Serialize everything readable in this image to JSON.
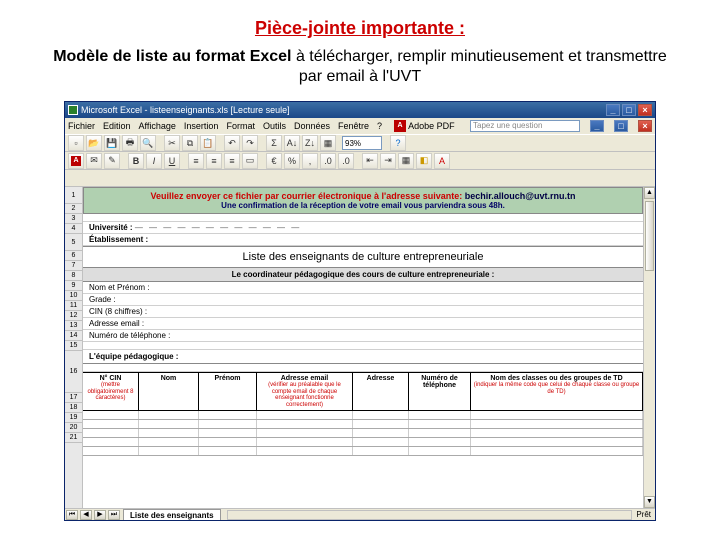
{
  "header": {
    "title_red": "Pièce-jointe importante :",
    "subtitle_bold": "Modèle de liste au format Excel",
    "subtitle_rest": " à télécharger, remplir minutieusement et transmettre par email à l'UVT"
  },
  "titlebar": {
    "app": "Microsoft Excel - listeenseignants.xls [Lecture seule]",
    "min": "_",
    "max": "□",
    "close": "×"
  },
  "menubar": {
    "file": "Fichier",
    "edit": "Edition",
    "view": "Affichage",
    "insert": "Insertion",
    "format": "Format",
    "tools": "Outils",
    "data": "Données",
    "window": "Fenêtre",
    "help": "?",
    "adobe": "Adobe PDF",
    "help_hint": "Tapez une question"
  },
  "toolbar": {
    "zoom": "93%"
  },
  "rows": [
    "",
    "1",
    "2",
    "3",
    "4",
    "5",
    "6",
    "7",
    "8",
    "9",
    "10",
    "11",
    "12",
    "13",
    "14",
    "15",
    "16",
    "17",
    "18",
    "19",
    "20",
    "21"
  ],
  "sheet": {
    "banner_l1_pre": "Veuillez envoyer ce fichier par courrier électronique à l'adresse suivante: ",
    "banner_l1_mail": "bechir.allouch@uvt.rnu.tn",
    "banner_l2": "Une confirmation de la réception de votre email vous parviendra sous 48h.",
    "universite": "Université :",
    "dashes": "— — — — — — — — — — — —",
    "etab": "Établissement :",
    "liste_title": "Liste des enseignants de culture entrepreneuriale",
    "coord_header": "Le coordinateur pédagogique des cours de culture entrepreneuriale :",
    "nom_prenom": "Nom et Prénom :",
    "grade": "Grade :",
    "cin": "CIN (8 chiffres) :",
    "email": "Adresse email :",
    "tel": "Numéro de téléphone :",
    "equipe": "L'équipe pédagogique :",
    "col_num": "N° CIN",
    "col_num_sub": "(mettre obligatoirement 8 caractères)",
    "col_nom": "Nom",
    "col_prenom": "Prénom",
    "col_mail": "Adresse email",
    "col_mail_sub": "(vérifier au préalable que le compte email de chaque enseignant fonctionne correctement)",
    "col_addr": "Adresse",
    "col_tel": "Numéro de téléphone",
    "col_class": "Nom des classes ou des groupes de TD",
    "col_class_sub": "(indiquer la même code que celui de chaque classe ou groupe de TD)"
  },
  "tabs": {
    "sheet1": "Liste des enseignants"
  },
  "status": {
    "ready": "Prêt"
  }
}
